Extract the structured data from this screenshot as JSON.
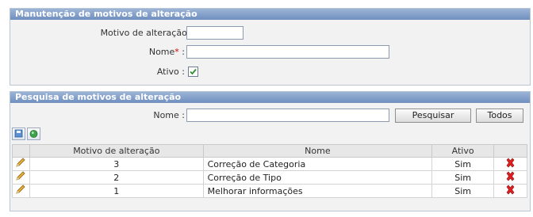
{
  "maintenance": {
    "title": "Manutenção de motivos de alteração",
    "fields": {
      "motivo_label": "Motivo de alteração :",
      "motivo_value": "",
      "nome_label": "Nome",
      "nome_required_mark": "*",
      "nome_colon": " :",
      "nome_value": "",
      "ativo_label": "Ativo :",
      "ativo_checked": true
    }
  },
  "search": {
    "title": "Pesquisa de motivos de alteração",
    "nome_label": "Nome :",
    "nome_value": "",
    "search_button": "Pesquisar",
    "all_button": "Todos",
    "toolbar_icons": [
      "save-icon",
      "refresh-icon"
    ]
  },
  "table": {
    "columns": [
      "",
      "Motivo de alteração",
      "Nome",
      "Ativo",
      ""
    ],
    "rows": [
      {
        "motivo": "3",
        "nome": "Correção de Categoria",
        "ativo": "Sim"
      },
      {
        "motivo": "2",
        "nome": "Correção de Tipo",
        "ativo": "Sim"
      },
      {
        "motivo": "1",
        "nome": "Melhorar informações",
        "ativo": "Sim"
      }
    ]
  },
  "colors": {
    "header_gradient_top": "#9cb4d6",
    "header_gradient_bottom": "#6f8fbf",
    "panel_bg": "#f2f2f2",
    "required": "#d00000",
    "delete": "#e02020",
    "edit": "#d9a420"
  }
}
